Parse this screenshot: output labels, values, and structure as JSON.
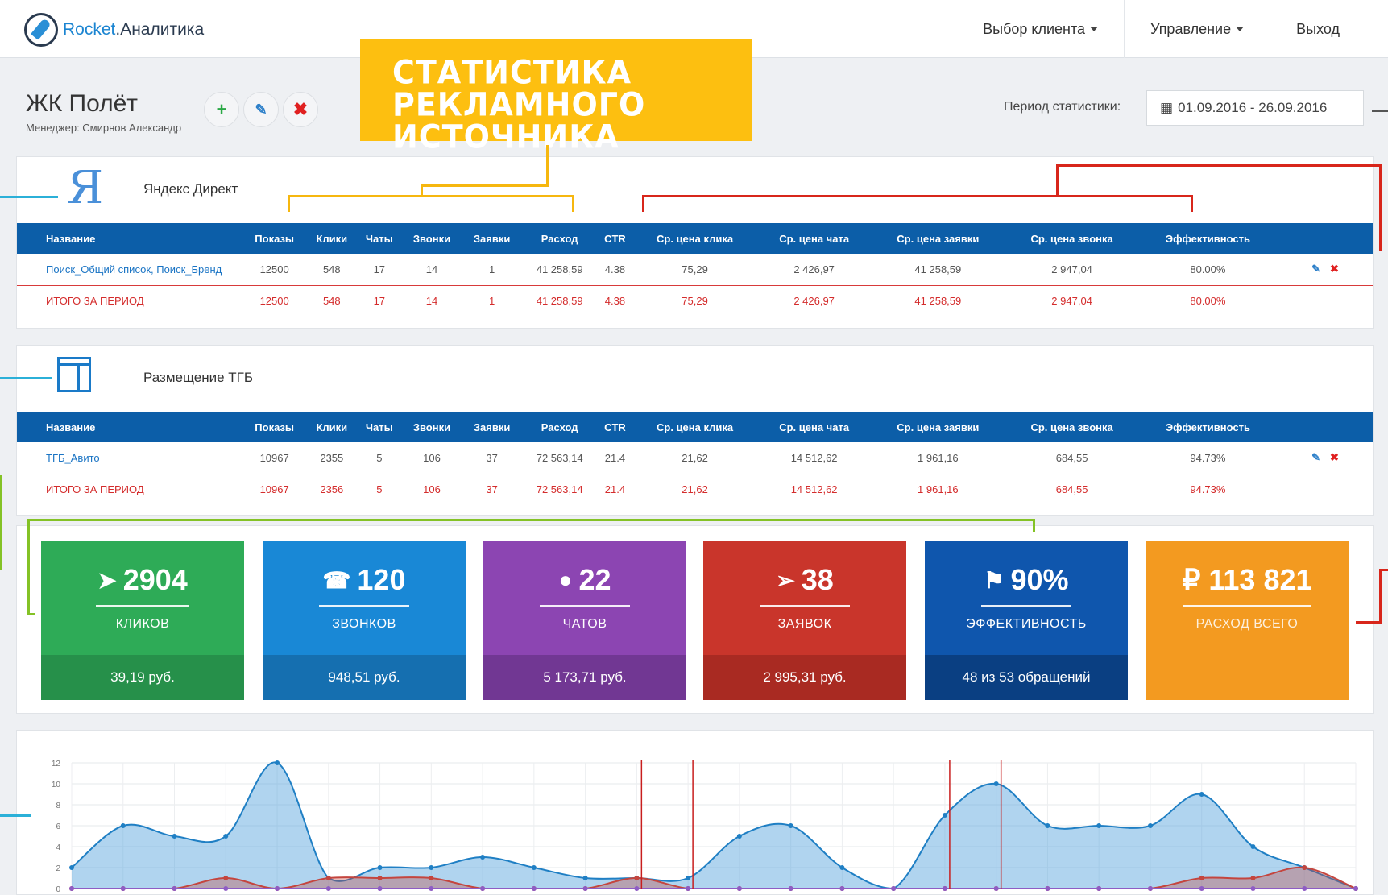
{
  "brand": {
    "part1": "Rocket",
    "part2": ".Аналитика"
  },
  "nav": {
    "client": "Выбор клиента",
    "manage": "Управление",
    "logout": "Выход"
  },
  "project": {
    "title": "ЖК Полёт",
    "manager": "Менеджер: Смирнов Александр"
  },
  "callout": {
    "line1": "СТАТИСТИКА РЕКЛАМНОГО",
    "line2": "ИСТОЧНИКА"
  },
  "period": {
    "label": "Период статистики:",
    "value": "01.09.2016 - 26.09.2016"
  },
  "columns": [
    "Название",
    "Показы",
    "Клики",
    "Чаты",
    "Звонки",
    "Заявки",
    "Расход",
    "CTR",
    "Ср. цена клика",
    "Ср. цена чата",
    "Ср. цена заявки",
    "Ср. цена звонка",
    "Эффективность"
  ],
  "sources": [
    {
      "name": "Яндекс Директ",
      "logo": "yandex-logo",
      "rows": [
        [
          "Поиск_Общий список, Поиск_Бренд",
          "12500",
          "548",
          "17",
          "14",
          "1",
          "41 258,59",
          "4.38",
          "75,29",
          "2 426,97",
          "41 258,59",
          "2 947,04",
          "80.00%"
        ]
      ],
      "total": [
        "ИТОГО ЗА ПЕРИОД",
        "12500",
        "548",
        "17",
        "14",
        "1",
        "41 258,59",
        "4.38",
        "75,29",
        "2 426,97",
        "41 258,59",
        "2 947,04",
        "80.00%"
      ]
    },
    {
      "name": "Размещение ТГБ",
      "logo": "tgb-icon",
      "rows": [
        [
          "ТГБ_Авито",
          "10967",
          "2355",
          "5",
          "106",
          "37",
          "72 563,14",
          "21.4",
          "21,62",
          "14 512,62",
          "1 961,16",
          "684,55",
          "94.73%"
        ]
      ],
      "total": [
        "ИТОГО ЗА ПЕРИОД",
        "10967",
        "2356",
        "5",
        "106",
        "37",
        "72 563,14",
        "21.4",
        "21,62",
        "14 512,62",
        "1 961,16",
        "684,55",
        "94.73%"
      ]
    }
  ],
  "tiles": [
    {
      "icon": "cursor-icon",
      "value": "2904",
      "label": "КЛИКОВ",
      "foot": "39,19 руб.",
      "color": "#2eab57"
    },
    {
      "icon": "phone-icon",
      "value": "120",
      "label": "ЗВОНКОВ",
      "foot": "948,51 руб.",
      "color": "#1988d6"
    },
    {
      "icon": "chat-icon",
      "value": "22",
      "label": "ЧАТОВ",
      "foot": "5 173,71 руб.",
      "color": "#8c45b2"
    },
    {
      "icon": "send-icon",
      "value": "38",
      "label": "ЗАЯВОК",
      "foot": "2 995,31 руб.",
      "color": "#c9352b"
    },
    {
      "icon": "flag-icon",
      "value": "90%",
      "label": "ЭФФЕКТИВНОСТЬ",
      "foot": "48 из 53 обращений",
      "color": "#0f56ad"
    },
    {
      "icon": "ruble-icon",
      "value": "₽ 113 821",
      "label": "РАСХОД ВСЕГО",
      "foot": "",
      "color": "#f39a20"
    }
  ],
  "chart_data": {
    "type": "area",
    "ylim": [
      0,
      12
    ],
    "yticks": [
      "0",
      "2",
      "4",
      "6",
      "8",
      "10",
      "12"
    ],
    "grid": true,
    "series": [
      {
        "color": "#1f7fc4",
        "values": [
          2,
          6,
          5,
          5,
          12,
          1,
          2,
          2,
          3,
          2,
          1,
          1,
          1,
          5,
          6,
          2,
          0,
          7,
          10,
          6,
          6,
          6,
          9,
          4,
          2,
          0
        ]
      },
      {
        "color": "#c4453e",
        "values": [
          0,
          0,
          0,
          1,
          0,
          1,
          1,
          1,
          0,
          0,
          0,
          1,
          0,
          0,
          0,
          0,
          0,
          0,
          0,
          0,
          0,
          0,
          1,
          1,
          2,
          0
        ]
      },
      {
        "color": "#8e5cc4",
        "values": [
          0,
          0,
          0,
          0,
          0,
          0,
          0,
          0,
          0,
          0,
          0,
          0,
          0,
          0,
          0,
          0,
          0,
          0,
          0,
          0,
          0,
          0,
          0,
          0,
          0,
          0
        ]
      }
    ],
    "markers": [
      11,
      12,
      17,
      18
    ]
  }
}
